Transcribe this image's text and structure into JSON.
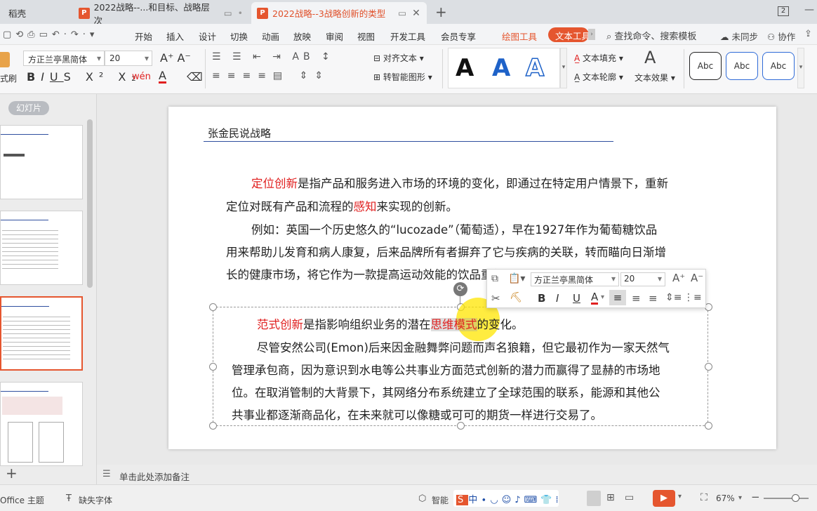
{
  "tabs": [
    {
      "label": "稻壳"
    },
    {
      "label": "2022战略--...和目标、战略层次"
    },
    {
      "label": "2022战略--3战略创新的类型"
    }
  ],
  "window": {
    "badge": "2"
  },
  "menu": {
    "items": [
      "开始",
      "插入",
      "设计",
      "切换",
      "动画",
      "放映",
      "审阅",
      "视图",
      "开发工具",
      "会员专享",
      "绘图工具",
      "文本工具"
    ],
    "search": "查找命令、搜索模板",
    "unsynced": "未同步",
    "collab": "协作"
  },
  "ribbon": {
    "font_family": "方正兰亭黑简体",
    "font_size": "20",
    "align_text": "对齐文本",
    "smart_shape": "转智能图形",
    "text_fill": "文本填充",
    "text_outline": "文本轮廓",
    "text_effect": "文本效果",
    "style_labels": [
      "Abc",
      "Abc",
      "Abc"
    ],
    "big_a": [
      "A",
      "A",
      "A"
    ],
    "format_label": "式刷"
  },
  "left_panel": {
    "label": "幻灯片"
  },
  "slide": {
    "header": "张金民说战略",
    "para1_term": "定位创新",
    "para1_rest": "是指产品和服务进入市场的环境的变化，即通过在特定用户情景下，重新",
    "para1_line2a": "定位对既有产品和流程的",
    "para1_line2_term": "感知",
    "para1_line2b": "来实现的创新。",
    "para2_line1": "例如：英国一个历史悠久的“lucozade”（葡萄适），早在1927年作为葡萄糖饮品",
    "para2_line2": "用来帮助儿发育和病人康复，后来品牌所有者摒弃了它与疾病的关联，转而瞄向日渐增",
    "para2_line3": "长的健康市场，将它作为一款提高运动效能的饮品重新推出。",
    "para3_term": "范式创新",
    "para3_mid": "是指影响组织业务的潜在",
    "para3_term2": "思维模式",
    "para3_end": "的变化。",
    "para4_line1": "尽管安然公司(Emon)后来因金融舞弊问题而声名狼籍，但它最初作为一家天然气",
    "para4_line2": "管理承包商，因为意识到水电等公共事业方面范式创新的潜力而赢得了显赫的市场地",
    "para4_line3": "位。在取消管制的大背景下，其网络分布系统建立了全球范围的联系，能源和其他公",
    "para4_line4": "共事业都逐渐商品化，在未来就可以像糖或可可的期货一样进行交易了。"
  },
  "floating_toolbar": {
    "font_family": "方正兰亭黑简体",
    "font_size": "20"
  },
  "notes": {
    "placeholder": "单击此处添加备注"
  },
  "status": {
    "theme": "Office 主题",
    "missing_font": "缺失字体",
    "smart": "智能",
    "zoom": "67%"
  },
  "colors": {
    "accent": "#e5562f",
    "highlight_red": "#e02020",
    "blue_rule": "#2f4f9f"
  }
}
